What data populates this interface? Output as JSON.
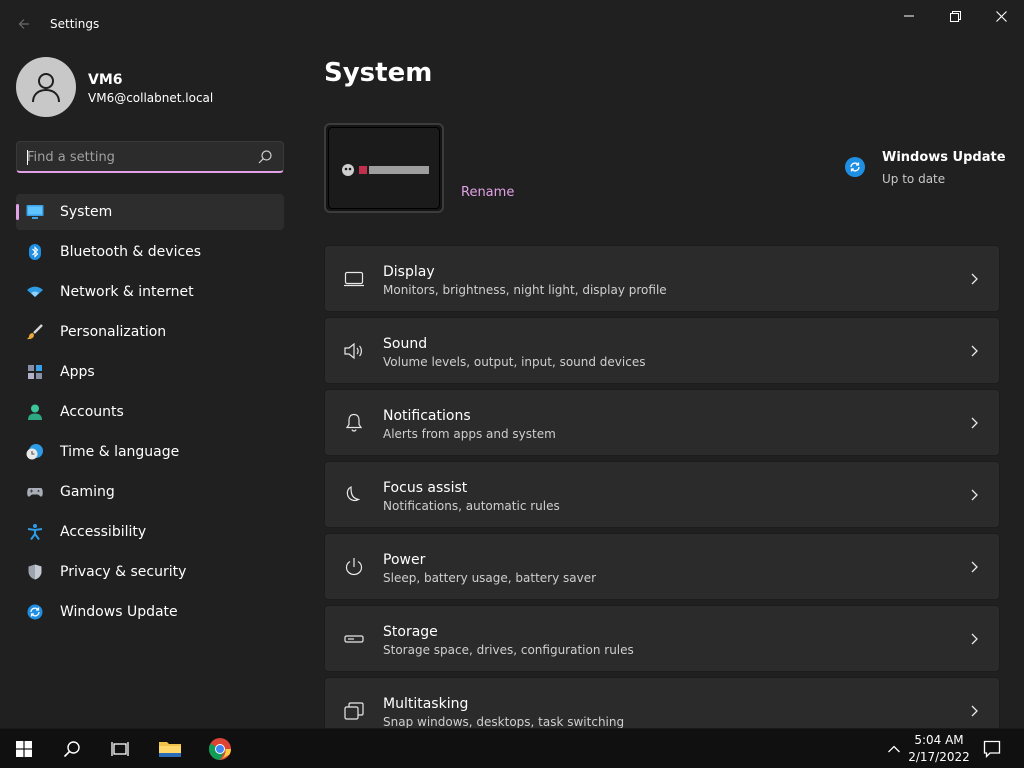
{
  "window": {
    "title": "Settings",
    "back_icon": "back-arrow-icon",
    "controls": [
      "minimize",
      "maximize",
      "close"
    ]
  },
  "user": {
    "name": "VM6",
    "email": "VM6@collabnet.local",
    "avatar_icon": "person-icon"
  },
  "search": {
    "placeholder": "Find a setting",
    "value": "",
    "icon": "search-icon"
  },
  "sidebar": {
    "items": [
      {
        "label": "System",
        "icon": "monitor-icon",
        "active": true
      },
      {
        "label": "Bluetooth & devices",
        "icon": "bluetooth-icon"
      },
      {
        "label": "Network & internet",
        "icon": "wifi-icon"
      },
      {
        "label": "Personalization",
        "icon": "brush-icon"
      },
      {
        "label": "Apps",
        "icon": "apps-icon"
      },
      {
        "label": "Accounts",
        "icon": "account-icon"
      },
      {
        "label": "Time & language",
        "icon": "clock-globe-icon"
      },
      {
        "label": "Gaming",
        "icon": "gamepad-icon"
      },
      {
        "label": "Accessibility",
        "icon": "accessibility-icon"
      },
      {
        "label": "Privacy & security",
        "icon": "shield-icon"
      },
      {
        "label": "Windows Update",
        "icon": "update-icon"
      }
    ]
  },
  "main": {
    "title": "System",
    "device": {
      "rename_label": "Rename"
    },
    "windows_update": {
      "title": "Windows Update",
      "status": "Up to date"
    },
    "cards": [
      {
        "title": "Display",
        "desc": "Monitors, brightness, night light, display profile",
        "icon": "display-icon"
      },
      {
        "title": "Sound",
        "desc": "Volume levels, output, input, sound devices",
        "icon": "speaker-icon"
      },
      {
        "title": "Notifications",
        "desc": "Alerts from apps and system",
        "icon": "bell-icon"
      },
      {
        "title": "Focus assist",
        "desc": "Notifications, automatic rules",
        "icon": "moon-icon"
      },
      {
        "title": "Power",
        "desc": "Sleep, battery usage, battery saver",
        "icon": "power-icon"
      },
      {
        "title": "Storage",
        "desc": "Storage space, drives, configuration rules",
        "icon": "storage-icon"
      },
      {
        "title": "Multitasking",
        "desc": "Snap windows, desktops, task switching",
        "icon": "multitasking-icon"
      }
    ]
  },
  "taskbar": {
    "time": "5:04 AM",
    "date": "2/17/2022"
  },
  "colors": {
    "accent": "#e2a1e6",
    "background": "#202020",
    "card": "#2b2b2b",
    "taskbar": "#101010"
  }
}
